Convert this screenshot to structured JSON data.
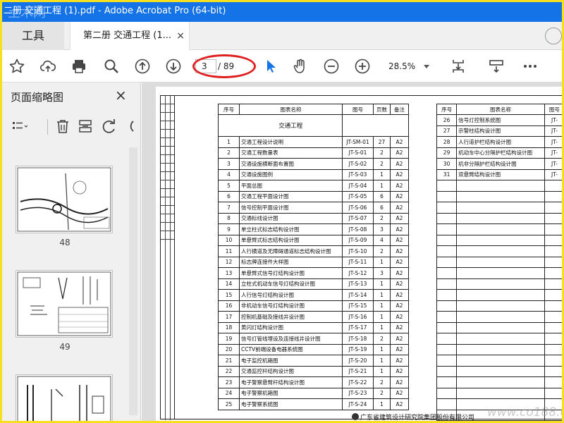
{
  "window": {
    "title": "二册 交通工程 (1).pdf - Adobe Acrobat Pro (64-bit)",
    "watermark_text": "土木网"
  },
  "tabs": {
    "tools_label": "工具",
    "document_label": "第二册 交通工程 (1...",
    "close_glyph": "×"
  },
  "toolbar": {
    "page_current": "3",
    "page_total": "/ 89",
    "zoom": "28.5%",
    "icons": [
      "star-icon",
      "cloud-upload-icon",
      "print-icon",
      "search-icon",
      "page-up-icon",
      "page-down-icon",
      "select-cursor-icon",
      "hand-icon",
      "zoom-out-icon",
      "zoom-in-icon",
      "fit-page-icon",
      "scroll-mode-icon",
      "more-icon"
    ],
    "highlight_color": "#e02020",
    "accent": "#1473e6"
  },
  "sidebar": {
    "title": "页面缩略图",
    "close_glyph": "×",
    "thumbnails": [
      {
        "page": "48"
      },
      {
        "page": "49"
      }
    ]
  },
  "document": {
    "headers": [
      "序号",
      "图表名称",
      "图号",
      "页数",
      "备注"
    ],
    "group_title": "交通工程",
    "rows_left": [
      [
        "1",
        "交通工程设计说明",
        "JT-SM-01",
        "27",
        "A2"
      ],
      [
        "2",
        "交通工程数量表",
        "JT-S-01",
        "2",
        "A2"
      ],
      [
        "3",
        "交通设施横断面布置图",
        "JT-S-02",
        "2",
        "A2"
      ],
      [
        "4",
        "交通设施图例",
        "JT-S-03",
        "1",
        "A2"
      ],
      [
        "5",
        "平面总图",
        "JT-S-04",
        "1",
        "A2"
      ],
      [
        "6",
        "交通工程平面设计图",
        "JT-S-05",
        "6",
        "A2"
      ],
      [
        "7",
        "信号控制平面设计图",
        "JT-S-06",
        "6",
        "A2"
      ],
      [
        "8",
        "交通标线设计图",
        "JT-S-07",
        "2",
        "A2"
      ],
      [
        "9",
        "单立柱式标志结构设计图",
        "JT-S-08",
        "3",
        "A2"
      ],
      [
        "10",
        "单悬臂式标志结构设计图",
        "JT-S-09",
        "4",
        "A2"
      ],
      [
        "11",
        "人行横道及无障碍通道标志结构设计图",
        "JT-S-10",
        "2",
        "A2"
      ],
      [
        "12",
        "标志牌连接件大样图",
        "JT-S-11",
        "1",
        "A2"
      ],
      [
        "13",
        "单悬臂式信号灯结构设计图",
        "JT-S-12",
        "3",
        "A2"
      ],
      [
        "14",
        "立柱式机动车信号灯结构设计图",
        "JT-S-13",
        "1",
        "A2"
      ],
      [
        "15",
        "人行信号灯结构设计图",
        "JT-S-14",
        "1",
        "A2"
      ],
      [
        "16",
        "非机动车信号灯结构设计图",
        "JT-S-15",
        "1",
        "A2"
      ],
      [
        "17",
        "控制机基础及接线井设计图",
        "JT-S-16",
        "1",
        "A2"
      ],
      [
        "18",
        "黄闪灯结构设计图",
        "JT-S-17",
        "1",
        "A2"
      ],
      [
        "19",
        "信号灯管线埋设及连接线井设计图",
        "JT-S-18",
        "2",
        "A2"
      ],
      [
        "20",
        "CCTV前端设备电器系统图",
        "JT-S-19",
        "1",
        "A2"
      ],
      [
        "21",
        "电子监控机箱图",
        "JT-S-20",
        "1",
        "A2"
      ],
      [
        "22",
        "交通监控杆结构设计图",
        "JT-S-21",
        "1",
        "A2"
      ],
      [
        "23",
        "电子警察悬臂杆结构设计图",
        "JT-S-22",
        "2",
        "A2"
      ],
      [
        "24",
        "电子警察机箱图",
        "JT-S-23",
        "2",
        "A2"
      ],
      [
        "25",
        "电子警察系统图",
        "JT-S-24",
        "1",
        "A2"
      ]
    ],
    "headers_right": [
      "序号",
      "图表名称",
      "图号"
    ],
    "rows_right": [
      [
        "26",
        "信号灯控制系统图",
        "JT-"
      ],
      [
        "27",
        "示警柱结构设计图",
        "JT-"
      ],
      [
        "28",
        "人行道护栏结构设计图",
        "JT-"
      ],
      [
        "29",
        "机动车中心分隔护栏结构设计图",
        "JT-"
      ],
      [
        "30",
        "机非分隔护栏结构设计图",
        "JT-"
      ],
      [
        "31",
        "双悬臂结构设计图",
        "JT-"
      ]
    ],
    "company": "广东省建筑设计研究院集团股份有限公司",
    "footer_watermark": "www.co188.com"
  }
}
